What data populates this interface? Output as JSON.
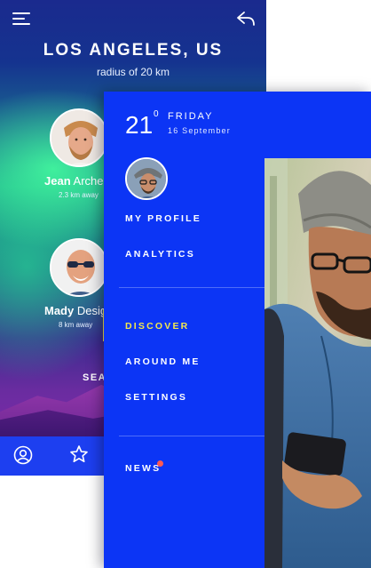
{
  "back_screen": {
    "city": "LOS ANGELES, US",
    "radius": "radius of 20 km",
    "users": [
      {
        "first": "Jean",
        "last": "Arche",
        "distance": "2.3 km away"
      },
      {
        "first": "Mady",
        "last": "Desig",
        "distance": "8 km away"
      }
    ],
    "search_label": "SEA",
    "icons": {
      "menu": "hamburger-menu-icon",
      "reply": "reply-arrow-icon",
      "profile": "user-profile-icon",
      "star": "star-icon"
    }
  },
  "drawer": {
    "temperature": "21",
    "degree": "0",
    "day": "FRIDAY",
    "date": "16 September",
    "menu_top": [
      "MY PROFILE",
      "ANALYTICS"
    ],
    "menu_mid": [
      "DISCOVER",
      "AROUND ME",
      "SETTINGS"
    ],
    "menu_bottom": [
      "NEWS"
    ],
    "active_item": "DISCOVER"
  },
  "colors": {
    "drawer_bg": "#0c35f5",
    "accent_yellow": "#f3e84d",
    "badge_red": "#ff5a52",
    "tab_bar": "#1d3ff0"
  }
}
